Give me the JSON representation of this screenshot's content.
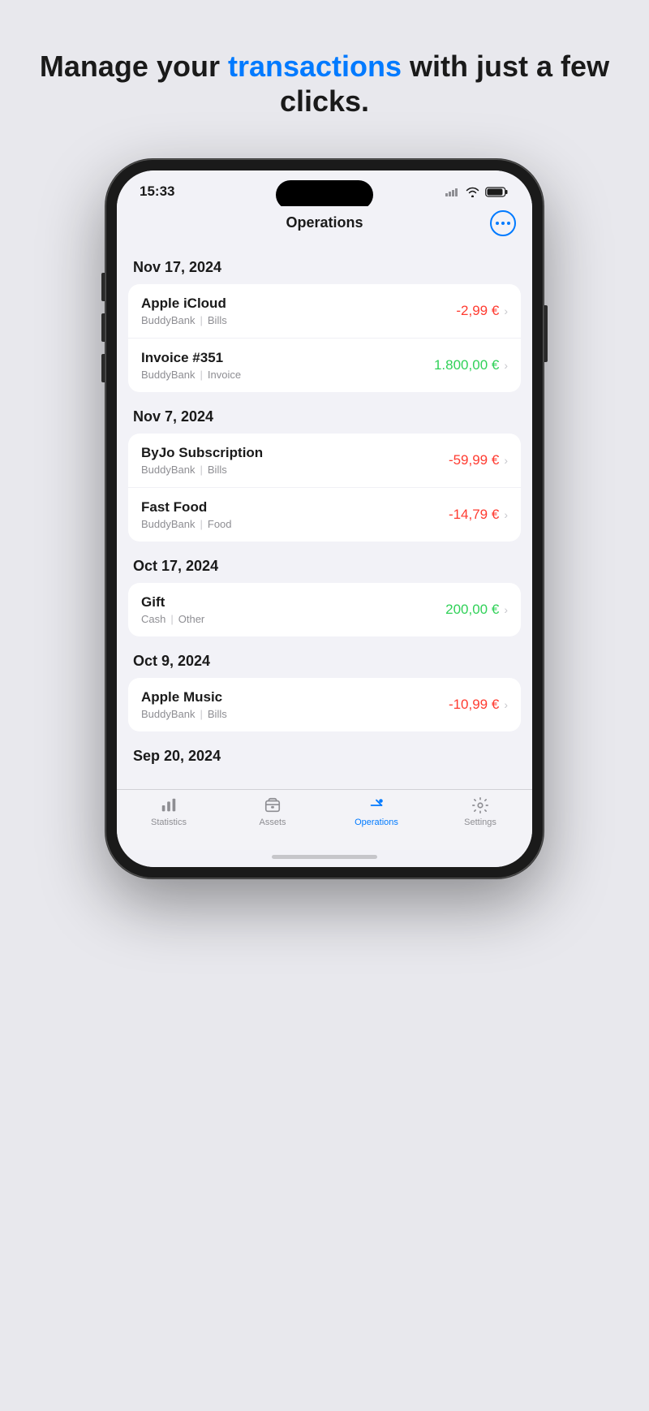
{
  "page": {
    "headline_part1": "Manage your ",
    "headline_highlight": "transactions",
    "headline_part2": " with just a few clicks."
  },
  "status_bar": {
    "time": "15:33"
  },
  "nav": {
    "title": "Operations"
  },
  "transactions": [
    {
      "date": "Nov 17, 2024",
      "items": [
        {
          "name": "Apple iCloud",
          "bank": "BuddyBank",
          "category": "Bills",
          "amount": "-2,99 €",
          "type": "negative"
        },
        {
          "name": "Invoice #351",
          "bank": "BuddyBank",
          "category": "Invoice",
          "amount": "1.800,00 €",
          "type": "positive"
        }
      ]
    },
    {
      "date": "Nov 7, 2024",
      "items": [
        {
          "name": "ByJo Subscription",
          "bank": "BuddyBank",
          "category": "Bills",
          "amount": "-59,99 €",
          "type": "negative"
        },
        {
          "name": "Fast Food",
          "bank": "BuddyBank",
          "category": "Food",
          "amount": "-14,79 €",
          "type": "negative"
        }
      ]
    },
    {
      "date": "Oct 17, 2024",
      "items": [
        {
          "name": "Gift",
          "bank": "Cash",
          "category": "Other",
          "amount": "200,00 €",
          "type": "positive"
        }
      ]
    },
    {
      "date": "Oct 9, 2024",
      "items": [
        {
          "name": "Apple Music",
          "bank": "BuddyBank",
          "category": "Bills",
          "amount": "-10,99 €",
          "type": "negative"
        }
      ]
    },
    {
      "date": "Sep 20, 2024",
      "items": []
    }
  ],
  "tabs": [
    {
      "label": "Statistics",
      "active": false,
      "icon": "bar-chart-icon"
    },
    {
      "label": "Assets",
      "active": false,
      "icon": "assets-icon"
    },
    {
      "label": "Operations",
      "active": true,
      "icon": "operations-icon"
    },
    {
      "label": "Settings",
      "active": false,
      "icon": "settings-icon"
    }
  ]
}
